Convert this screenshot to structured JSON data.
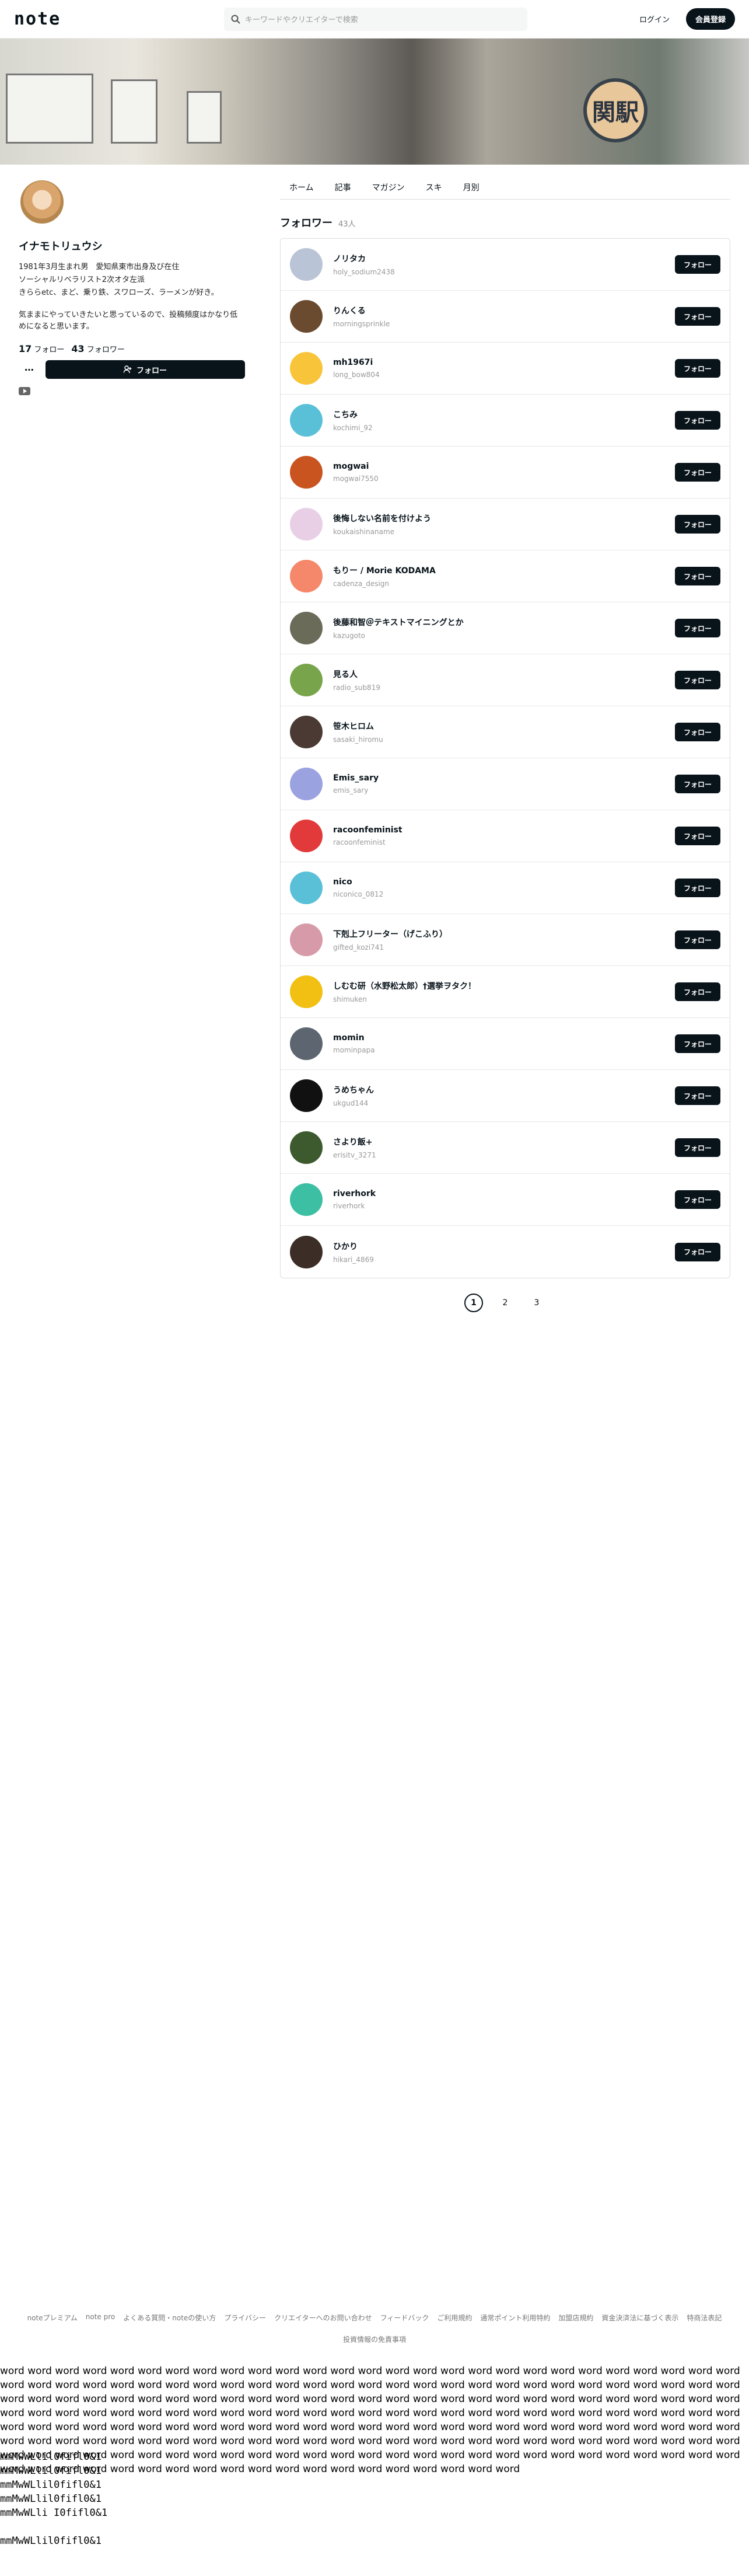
{
  "header": {
    "logo": "note",
    "search_placeholder": "キーワードやクリエイターで検索",
    "login": "ログイン",
    "signup": "会員登録"
  },
  "cover": {
    "sign_text": "関駅"
  },
  "profile": {
    "name": "イナモトリュウシ",
    "bio": [
      "1981年3月生まれ男　愛知県東市出身及び在住",
      "ソーシャルリベラリスト2次オタ左派",
      "きららetc、まど、乗り鉄、スワローズ、ラーメンが好き。",
      "",
      "気ままにやっていきたいと思っているので、投稿頻度はかなり低めになると思います。"
    ],
    "following_count": "17",
    "following_label": "フォロー",
    "followers_count": "43",
    "followers_label": "フォロワー",
    "more_label": "…",
    "follow_label": "フォロー"
  },
  "tabs": [
    "ホーム",
    "記事",
    "マガジン",
    "スキ",
    "月別"
  ],
  "section": {
    "title": "フォロワー",
    "count": "43人"
  },
  "followers": [
    {
      "name": "ノリタカ",
      "id": "holy_sodium2438",
      "color": "#b9c4d6"
    },
    {
      "name": "りんくる",
      "id": "morningsprinkle",
      "color": "#6b4b2f"
    },
    {
      "name": "mh1967i",
      "id": "long_bow804",
      "color": "#f8c43a"
    },
    {
      "name": "こちみ",
      "id": "kochimi_92",
      "color": "#5ac0d8"
    },
    {
      "name": "mogwai",
      "id": "mogwai7550",
      "color": "#c9541f"
    },
    {
      "name": "後悔しない名前を付けよう",
      "id": "koukaishinaname",
      "color": "#e8cfe6"
    },
    {
      "name": "もりー / Morie KODAMA",
      "id": "cadenza_design",
      "color": "#f5876a"
    },
    {
      "name": "後藤和智＠テキストマイニングとか",
      "id": "kazugoto",
      "color": "#6b6b5a"
    },
    {
      "name": "見る人",
      "id": "radio_sub819",
      "color": "#78a54b"
    },
    {
      "name": "笹木ヒロム",
      "id": "sasaki_hiromu",
      "color": "#4a3a33"
    },
    {
      "name": "Emis_sary",
      "id": "emis_sary",
      "color": "#9aa3e0"
    },
    {
      "name": "racoonfeminist",
      "id": "racoonfeminist",
      "color": "#e23a3a"
    },
    {
      "name": "nico",
      "id": "niconico_0812",
      "color": "#5ac0d8"
    },
    {
      "name": "下剋上フリーター（げこふり）",
      "id": "gifted_kozi741",
      "color": "#d79aa8"
    },
    {
      "name": "しむむ研（水野松太郎）†選挙ヲタク！",
      "id": "shimuken",
      "color": "#f1c012"
    },
    {
      "name": "momin",
      "id": "mominpapa",
      "color": "#5c6570"
    },
    {
      "name": "うめちゃん",
      "id": "ukgud144",
      "color": "#111111"
    },
    {
      "name": "さより飯+",
      "id": "erisitv_3271",
      "color": "#3d5a2f"
    },
    {
      "name": "riverhork",
      "id": "riverhork",
      "color": "#3dbfa3"
    },
    {
      "name": "ひかり",
      "id": "hikari_4869",
      "color": "#3c2d26"
    }
  ],
  "follow_button": "フォロー",
  "pages": [
    "1",
    "2",
    "3"
  ],
  "footer": {
    "links": [
      "noteプレミアム",
      "note pro",
      "よくある質問・noteの使い方",
      "プライバシー",
      "クリエイターへのお問い合わせ",
      "フィードバック",
      "ご利用規約",
      "通常ポイント利用特約",
      "加盟店規約",
      "資金決済法に基づく表示",
      "特商法表記"
    ],
    "copy": "投資情報の免責事項"
  },
  "filler": {
    "words": "word word word word word word word word word word word word word word word word word word word word word word word word word word word word word word word word word word word word word word word word word word word word word word word word word word word word word word word word word word word word word word word word word word word word word word word word word word word word word word word word word word word word word word word word word word word word word word word word word word word word word word word word word word word word word word word word word word word word word word word word word word word word word word word word word word word word word word word word word word word word word word word word word word word word word word word word word word word word word word word word word word word word word word word word word word word word word word word word word word word word word word word word word word word word word word word word word word word word word word word word word word word word word word word word",
    "mono": [
      "mmMwWLlil0fifl0&1",
      "mmMwWLlil0fifl0&1",
      "mmMwWLlil0fifl0&1",
      "mmMwWLlil0fifl0&1",
      "mmMwWLli I0fifl0&1",
      "",
      "mmMwWLlil0fifl0&1"
    ]
  }
}
